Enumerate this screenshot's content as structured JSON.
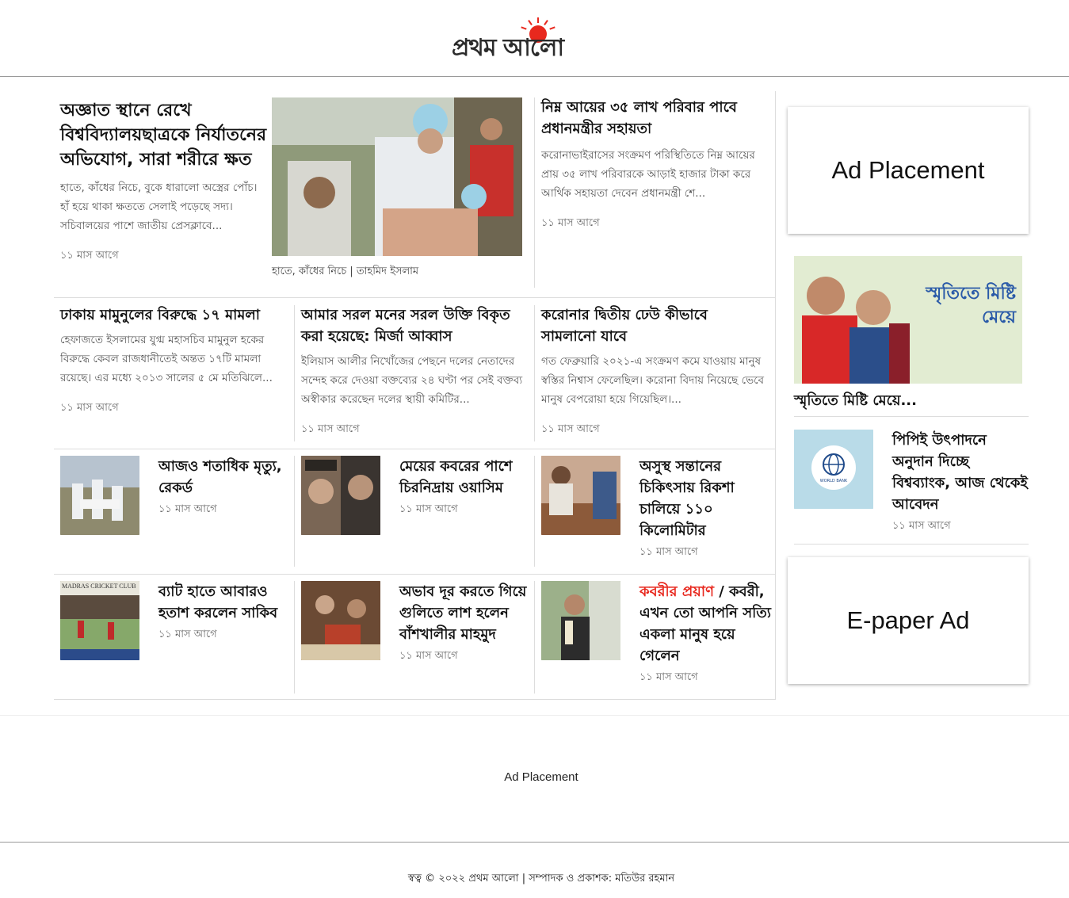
{
  "brand": {
    "name": "প্রথম আলো",
    "sun_color": "#e8281e"
  },
  "lead": {
    "title": "অজ্ঞাত স্থানে রেখে বিশ্ববিদ্যালয়ছাত্রকে নির্যাতনের অভিযোগ, সারা শরীরে ক্ষত",
    "summary": "হাতে, কাঁধের নিচে, বুকে ধারালো অস্ত্রের পোঁচ। হাঁ হয়ে থাকা ক্ষততে সেলাই পড়েছে সদ্য। সচিবালয়ের পাশে জাতীয় প্রেসক্লাবে...",
    "time": "১১ মাস আগে",
    "caption": "হাতে, কাঁধের নিচে | তাহমিদ ইসলাম"
  },
  "top_right": {
    "title": "নিম্ন আয়ের ৩৫ লাখ পরিবার পাবে প্রধানমন্ত্রীর সহায়তা",
    "summary": "করোনাভাইরাসের সংক্রমণ পরিস্থিতিতে নিম্ন আয়ের প্রায় ৩৫ লাখ পরিবারকে আড়াই হাজার টাকা করে আর্থিক সহায়তা দেবেন প্রধানমন্ত্রী শে...",
    "time": "১১ মাস আগে"
  },
  "row2": [
    {
      "title": "ঢাকায় মামুনুলের বিরুদ্ধে ১৭ মামলা",
      "summary": "হেফাজতে ইসলামের যুগ্ম মহাসচিব মামুনুল হকের বিরুদ্ধে কেবল রাজধানীতেই অন্তত ১৭টি মামলা রয়েছে। এর মধ্যে ২০১৩ সালের ৫ মে মতিঝিলে...",
      "time": "১১ মাস আগে"
    },
    {
      "title": "আমার সরল মনের সরল উক্তি বিকৃত করা হয়েছে: মির্জা আব্বাস",
      "summary": "ইলিয়াস আলীর নিখোঁজের পেছনে দলের নেতাদের সন্দেহ করে দেওয়া বক্তব্যের ২৪ ঘণ্টা পর সেই বক্তব্য অস্বীকার করেছেন দলের স্থায়ী কমিটির...",
      "time": "১১ মাস আগে"
    },
    {
      "title": "করোনার দ্বিতীয় ঢেউ কীভাবে সামলানো যাবে",
      "summary": "গত ফেব্রুয়ারি ২০২১-এ সংক্রমণ কমে যাওয়ায় মানুষ স্বস্তির নিশ্বাস ফেলেছিল। করোনা বিদায় নিয়েছে ভেবে মানুষ বেপরোয়া হয়ে গিয়েছিল।...",
      "time": "১১ মাস আগে"
    }
  ],
  "row3": [
    {
      "title": "আজও শতাধিক মৃত্যু, রেকর্ড",
      "time": "১১ মাস আগে"
    },
    {
      "title": "মেয়ের কবরের পাশে চিরনিদ্রায় ওয়াসিম",
      "time": "১১ মাস আগে"
    },
    {
      "title": "অসুস্থ সন্তানের চিকিৎসায় রিকশা চালিয়ে ১১০ কিলোমিটার",
      "time": "১১ মাস আগে"
    }
  ],
  "row4": [
    {
      "title": "ব্যাট হাতে আবারও হতাশ করলেন সাকিব",
      "time": "১১ মাস আগে",
      "thumb_text": "MADRAS CRICKET CLUB"
    },
    {
      "title": "অভাব দূর করতে গিয়ে গুলিতে লাশ হলেন বাঁশখালীর মাহমুদ",
      "time": "১১ মাস আগে"
    },
    {
      "kicker": "কবরীর প্রয়াণ",
      "separator": " / ",
      "title": "কবরী, এখন তো আপনি সত্যি একলা মানুষ হয়ে গেলেন",
      "time": "১১ মাস আগে",
      "kicker_color": "#e8281e"
    }
  ],
  "sidebar": {
    "ad1": "Ad Placement",
    "feature": {
      "title": "স্মৃতিতে মিষ্টি মেয়ে...",
      "image_text": "স্মৃতিতে মিষ্টি মেয়ে"
    },
    "story": {
      "title": "পিপিই উৎপাদনে অনুদান দিচ্ছে বিশ্বব্যাংক, আজ থেকেই আবেদন",
      "time": "১১ মাস আগে",
      "logo_text": "WORLD BANK"
    },
    "ad2": "E-paper Ad"
  },
  "bottom_ad": "Ad Placement",
  "footer": {
    "text": "স্বত্ব © ২০২২ প্রথম আলো | সম্পাদক ও প্রকাশক: মতিউর রহমান"
  }
}
